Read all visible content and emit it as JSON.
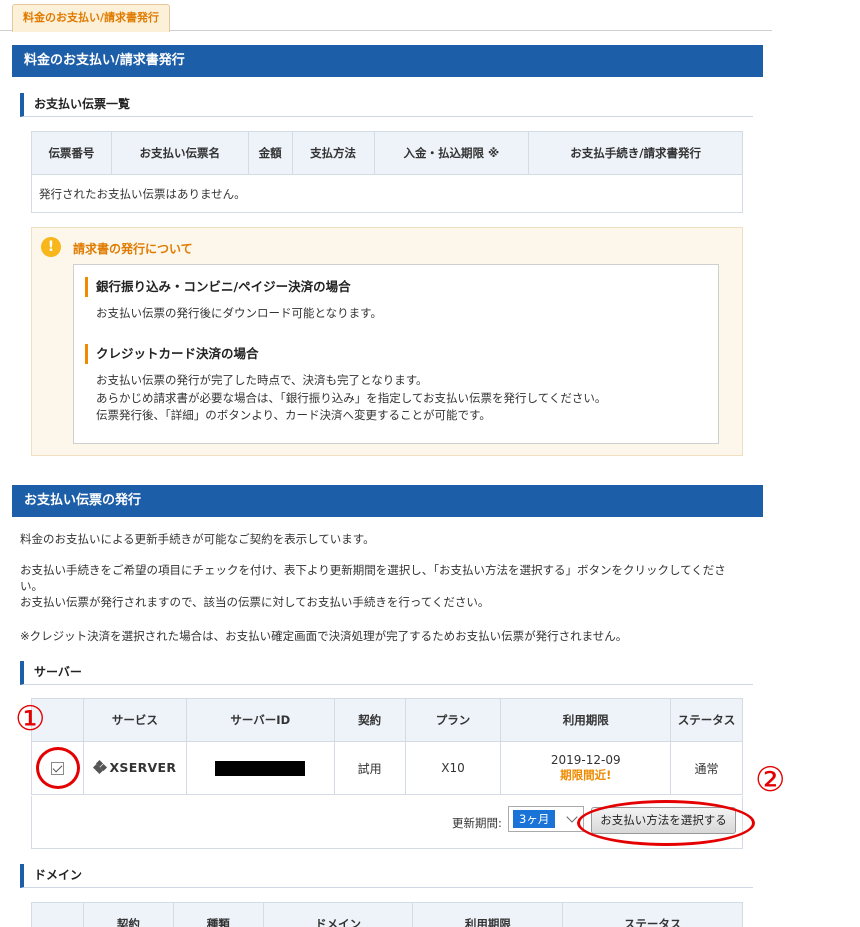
{
  "tab": {
    "label": "料金のお支払い/請求書発行"
  },
  "band1": {
    "title": "料金のお支払い/請求書発行"
  },
  "invoice_list": {
    "title": "お支払い伝票一覧",
    "headers": [
      "伝票番号",
      "お支払い伝票名",
      "金額",
      "支払方法",
      "入金・払込期限 ※",
      "お支払手続き/請求書発行"
    ],
    "empty_text": "発行されたお支払い伝票はありません。"
  },
  "notice": {
    "icon": "exclamation-icon",
    "title": "請求書の発行について",
    "sec1_title": "銀行振り込み・コンビニ/ペイジー決済の場合",
    "sec1_text": "お支払い伝票の発行後にダウンロード可能となります。",
    "sec2_title": "クレジットカード決済の場合",
    "sec2_line1": "お支払い伝票の発行が完了した時点で、決済も完了となります。",
    "sec2_line2": "あらかじめ請求書が必要な場合は、「銀行振り込み」を指定してお支払い伝票を発行してください。",
    "sec2_line3": "伝票発行後、「詳細」のボタンより、カード決済へ変更することが可能です。"
  },
  "band2": {
    "title": "お支払い伝票の発行"
  },
  "intro": {
    "p1": "料金のお支払いによる更新手続きが可能なご契約を表示しています。",
    "p2_line1": "お支払い手続きをご希望の項目にチェックを付け、表下より更新期間を選択し、「お支払い方法を選択する」ボタンをクリックしてくださ",
    "p2_line2": "い。",
    "p2_line3": "お支払い伝票が発行されますので、該当の伝票に対してお支払い手続きを行ってください。",
    "p3": "※クレジット決済を選択された場合は、お支払い確定画面で決済処理が完了するためお支払い伝票が発行されません。"
  },
  "server": {
    "title": "サーバー",
    "headers": [
      "",
      "サービス",
      "サーバーID",
      "契約",
      "プラン",
      "利用期限",
      "ステータス"
    ],
    "row": {
      "checked": true,
      "service": "XSERVER",
      "contract": "試用",
      "plan": "X10",
      "expiry": "2019-12-09",
      "expiry_note": "期限間近!",
      "status": "通常"
    },
    "renew_label": "更新期間:",
    "renew_value": "3ヶ月",
    "select_button": "お支払い方法を選択する"
  },
  "annotations": {
    "one": "①",
    "two": "②"
  },
  "domain": {
    "title": "ドメイン",
    "headers": [
      "",
      "契約",
      "種類",
      "ドメイン",
      "利用期限",
      "ステータス"
    ]
  },
  "colors": {
    "band": "#1d5ea8",
    "accent": "#e07b00",
    "annotation": "#e40000",
    "warn": "#ee8a00"
  }
}
